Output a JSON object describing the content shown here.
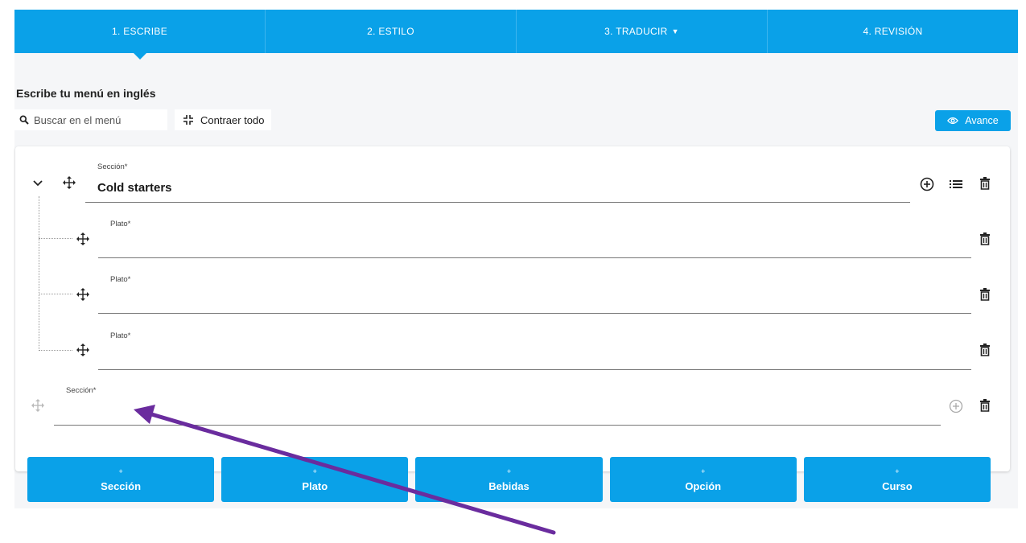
{
  "tabs": [
    {
      "label": "1. ESCRIBE",
      "active": true
    },
    {
      "label": "2. ESTILO",
      "active": false
    },
    {
      "label": "3. TRADUCIR",
      "active": false,
      "has_dropdown": true
    },
    {
      "label": "4. REVISIÓN",
      "active": false
    }
  ],
  "page_title": "Escribe tu menú en inglés",
  "toolbar": {
    "search_placeholder": "Buscar en el menú",
    "collapse_label": "Contraer todo",
    "preview_label": "Avance"
  },
  "sections": [
    {
      "label": "Sección*",
      "value": "Cold starters",
      "dishes": [
        {
          "label": "Plato*",
          "value": ""
        },
        {
          "label": "Plato*",
          "value": ""
        },
        {
          "label": "Plato*",
          "value": ""
        }
      ]
    },
    {
      "label": "Sección*",
      "value": "",
      "dishes": []
    }
  ],
  "add_buttons": [
    {
      "plus": "+",
      "label": "Sección"
    },
    {
      "plus": "+",
      "label": "Plato"
    },
    {
      "plus": "+",
      "label": "Bebidas"
    },
    {
      "plus": "+",
      "label": "Opción"
    },
    {
      "plus": "+",
      "label": "Curso"
    }
  ],
  "colors": {
    "primary": "#0aa1e8",
    "annotation_arrow": "#6a2c9e"
  },
  "icons": [
    "search-icon",
    "collapse-icon",
    "eye-icon",
    "chevron-down-icon",
    "move-icon",
    "add-circle-icon",
    "list-icon",
    "trash-icon"
  ]
}
